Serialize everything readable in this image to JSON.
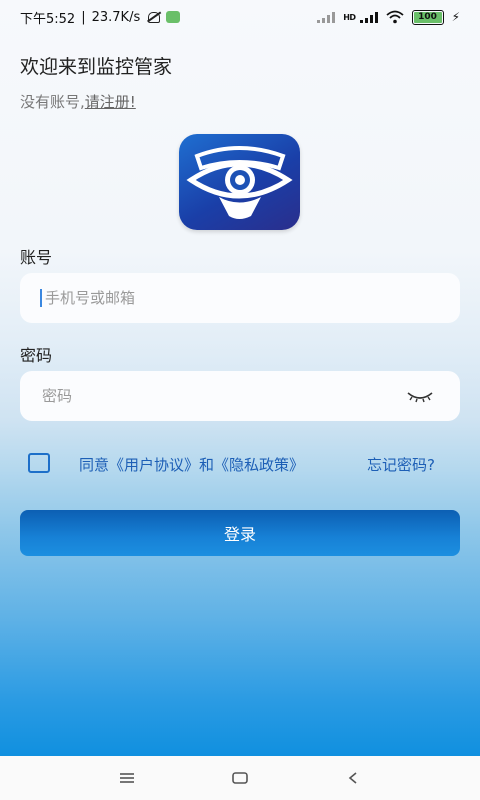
{
  "status_bar": {
    "time": "下午5:52",
    "speed": "23.7K/s",
    "network_badge": "HD",
    "battery_level": "100",
    "icons": [
      "mute-bell-icon",
      "app-notification-icon",
      "signal-icon",
      "signal-icon",
      "wifi-icon",
      "battery-icon",
      "charging-icon"
    ]
  },
  "header": {
    "welcome": "欢迎来到监控管家",
    "no_account_text": "没有账号,",
    "register_link": "请注册!"
  },
  "logo": {
    "icon": "eye-shield-icon"
  },
  "form": {
    "account_label": "账号",
    "account_placeholder": "手机号或邮箱",
    "password_label": "密码",
    "password_placeholder": "密码",
    "password_toggle_icon": "eye-closed-icon"
  },
  "agreement": {
    "checked": false,
    "text": "同意《用户协议》和《隐私政策》",
    "forgot": "忘记密码?"
  },
  "login_button": "登录",
  "nav": {
    "icons": [
      "menu-icon",
      "home-icon",
      "back-icon"
    ]
  }
}
